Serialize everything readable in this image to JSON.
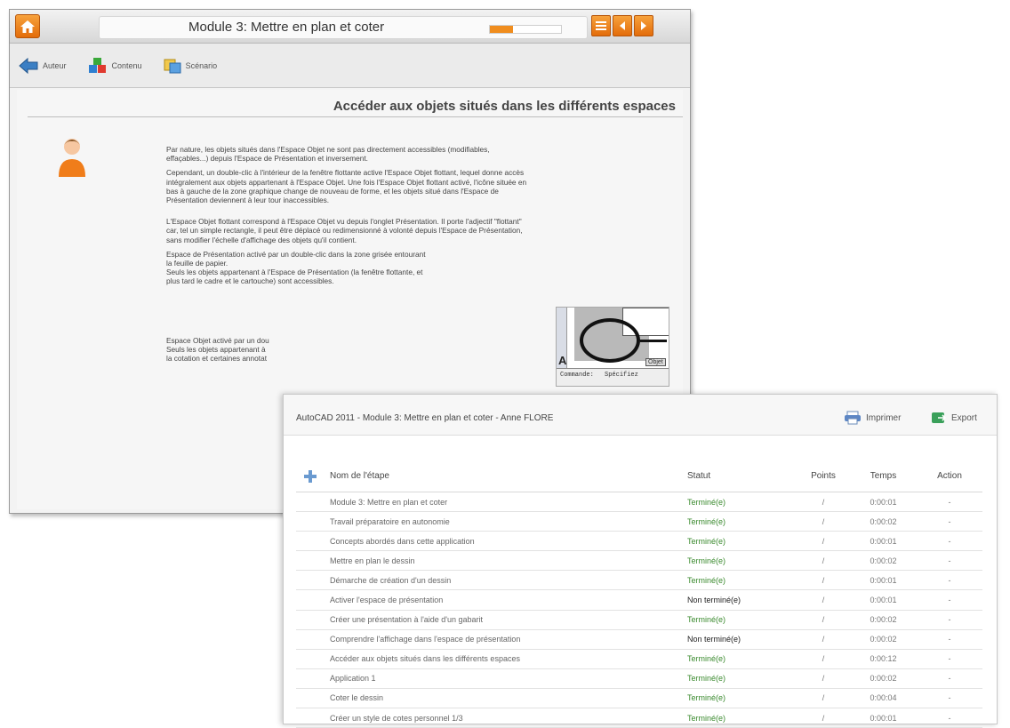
{
  "course": {
    "title": "Module 3: Mettre en plan et coter",
    "progress": 0.32,
    "toolbar": {
      "auteur": "Auteur",
      "contenu": "Contenu",
      "scenario": "Scénario"
    },
    "section_title": "Accéder aux objets situés dans les différents espaces",
    "paragraphs": [
      "Par nature, les objets situés dans l'Espace Objet ne sont pas directement accessibles (modifiables, effaçables...) depuis l'Espace de Présentation et inversement.",
      "Cependant, un double-clic à l'intérieur de la fenêtre flottante active l'Espace Objet flottant, lequel donne accès intégralement aux objets appartenant à l'Espace Objet. Une fois l'Espace Objet flottant activé, l'icône située en bas à gauche de la zone graphique change de nouveau de forme, et les objets situé dans l'Espace de Présentation deviennent à leur tour inaccessibles.",
      "L'Espace Objet flottant correspond à l'Espace Objet vu depuis l'onglet Présentation. Il porte l'adjectif \"flottant\" car, tel un simple rectangle, il peut être déplacé ou redimensionné à volonté depuis l'Espace de Présentation, sans modifier l'échelle d'affichage des objets qu'il contient.",
      "Espace de Présentation activé par un double-clic dans la zone grisée entourant la feuille de papier.\nSeuls les objets appartenant à l'Espace de Présentation (la fenêtre flottante, et plus tard le cadre et le cartouche) sont accessibles.",
      "Espace Objet activé par un dou\nSeuls les objets appartenant à\nla cotation et certaines annotat"
    ],
    "diagram": {
      "letter": "A",
      "tab": "Objet",
      "commande": "Commande:",
      "specif": "Spécifiez"
    }
  },
  "report": {
    "title": "AutoCAD 2011 - Module 3: Mettre en plan et coter - Anne FLORE",
    "print_label": "Imprimer",
    "export_label": "Export",
    "headers": {
      "name": "Nom de l'étape",
      "status": "Statut",
      "points": "Points",
      "time": "Temps",
      "action": "Action"
    },
    "rows": [
      {
        "name": "Module 3: Mettre en plan et coter",
        "status": "Terminé(e)",
        "points": "/",
        "time": "0:00:01",
        "action": "-"
      },
      {
        "name": "Travail préparatoire en autonomie",
        "status": "Terminé(e)",
        "points": "/",
        "time": "0:00:02",
        "action": "-"
      },
      {
        "name": "Concepts abordés dans cette application",
        "status": "Terminé(e)",
        "points": "/",
        "time": "0:00:01",
        "action": "-"
      },
      {
        "name": "Mettre en plan le dessin",
        "status": "Terminé(e)",
        "points": "/",
        "time": "0:00:02",
        "action": "-"
      },
      {
        "name": "Démarche de création d'un dessin",
        "status": "Terminé(e)",
        "points": "/",
        "time": "0:00:01",
        "action": "-"
      },
      {
        "name": "Activer l'espace de présentation",
        "status": "Non terminé(e)",
        "points": "/",
        "time": "0:00:01",
        "action": "-"
      },
      {
        "name": "Créer une présentation à l'aide d'un gabarit",
        "status": "Terminé(e)",
        "points": "/",
        "time": "0:00:02",
        "action": "-"
      },
      {
        "name": "Comprendre l'affichage dans l'espace de présentation",
        "status": "Non terminé(e)",
        "points": "/",
        "time": "0:00:02",
        "action": "-"
      },
      {
        "name": "Accéder aux objets situés dans les différents espaces",
        "status": "Terminé(e)",
        "points": "/",
        "time": "0:00:12",
        "action": "-"
      },
      {
        "name": "Application 1",
        "status": "Terminé(e)",
        "points": "/",
        "time": "0:00:02",
        "action": "-"
      },
      {
        "name": "Coter le dessin",
        "status": "Terminé(e)",
        "points": "/",
        "time": "0:00:04",
        "action": "-"
      },
      {
        "name": "Créer un style de cotes personnel 1/3",
        "status": "Terminé(e)",
        "points": "/",
        "time": "0:00:01",
        "action": "-"
      }
    ]
  },
  "colors": {
    "accent_orange": "#e36c0a",
    "done_green": "#3a8a2e"
  }
}
